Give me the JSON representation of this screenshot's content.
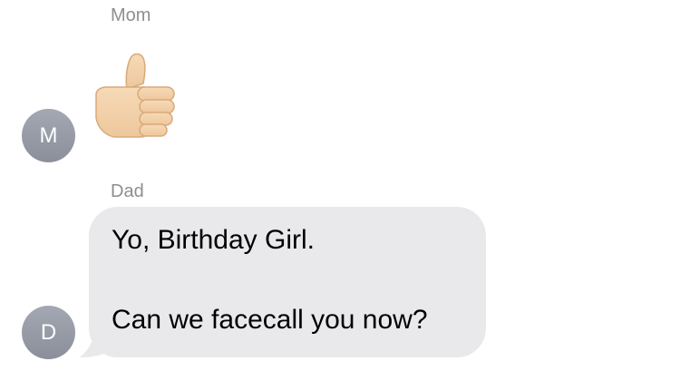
{
  "messages": [
    {
      "sender": "Mom",
      "avatar_initial": "M",
      "content_type": "emoji",
      "emoji": "thumbs-up",
      "emoji_icon": "thumbs-up-icon"
    },
    {
      "sender": "Dad",
      "avatar_initial": "D",
      "content_type": "text",
      "lines": [
        "Yo, Birthday Girl.",
        "Can we facecall you now?"
      ]
    }
  ],
  "colors": {
    "bubble_background": "#e9e9eb",
    "sender_name": "#8e8e93",
    "avatar_top": "#a3a8b3",
    "avatar_bottom": "#8a8f9a",
    "emoji_skin": "#f2d0a8"
  }
}
